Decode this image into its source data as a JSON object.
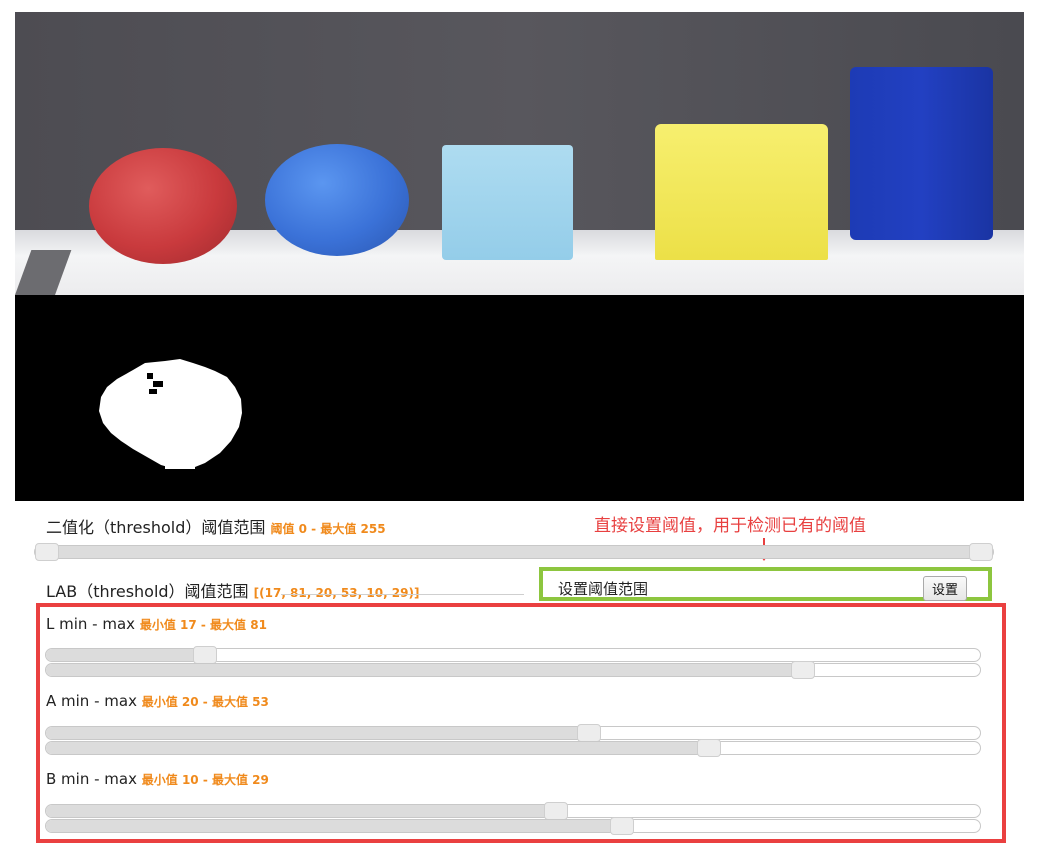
{
  "camera": {
    "label": "camera-feed"
  },
  "threshold": {
    "label": "二值化（threshold）阈值范围",
    "value_text": "阈值 0 - 最大值 255",
    "min": 0,
    "max": 255
  },
  "annotation": {
    "text": "直接设置阈值，用于检测已有的阈值"
  },
  "lab": {
    "label": "LAB（threshold）阈值范围",
    "value_text": "[(17, 81, 20, 53, 10, 29)]"
  },
  "set_range": {
    "label": "设置阈值范围",
    "button": "设置"
  },
  "sliders": {
    "l": {
      "label": "L min - max",
      "value_text": "最小值 17 - 最大值 81",
      "min": 17,
      "max": 81
    },
    "a": {
      "label": "A min - max",
      "value_text": "最小值 20 - 最大值 53",
      "min": 20,
      "max": 53
    },
    "b": {
      "label": "B min - max",
      "value_text": "最小值 10 - 最大值 29",
      "min": 10,
      "max": 29
    }
  }
}
